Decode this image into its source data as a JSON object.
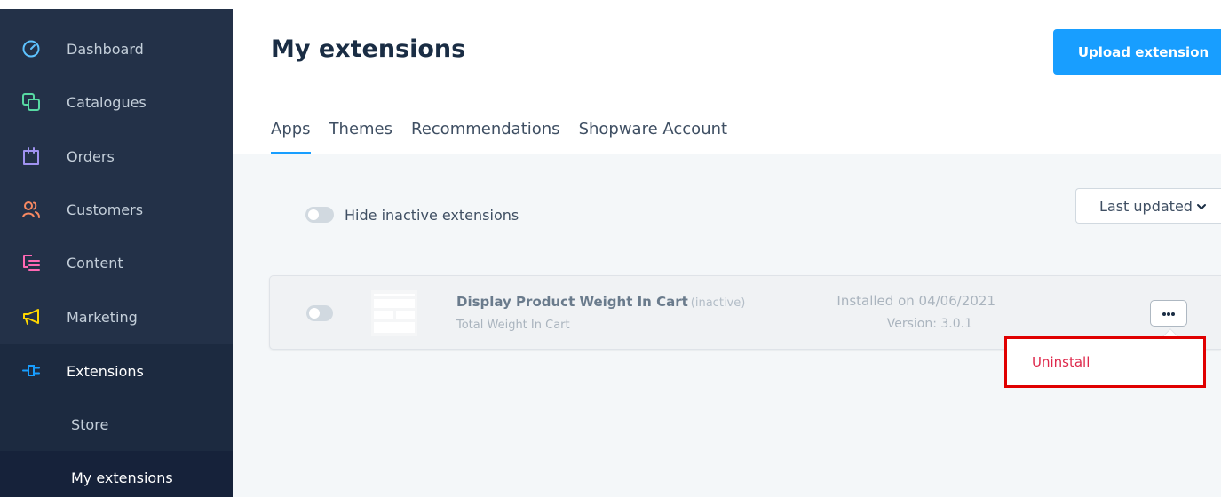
{
  "sidebar": {
    "items": [
      {
        "label": "Dashboard",
        "icon": "dashboard-gauge-icon",
        "color": "#5ec3ff"
      },
      {
        "label": "Catalogues",
        "icon": "catalogue-stack-icon",
        "color": "#57d9a3"
      },
      {
        "label": "Orders",
        "icon": "shopping-bag-icon",
        "color": "#a092f0"
      },
      {
        "label": "Customers",
        "icon": "users-icon",
        "color": "#f88962"
      },
      {
        "label": "Content",
        "icon": "content-layout-icon",
        "color": "#ff68b4"
      },
      {
        "label": "Marketing",
        "icon": "megaphone-icon",
        "color": "#ffd700"
      },
      {
        "label": "Extensions",
        "icon": "plug-icon",
        "color": "#189eff"
      }
    ],
    "sub_items": [
      {
        "label": "Store"
      },
      {
        "label": "My extensions"
      }
    ]
  },
  "header": {
    "title": "My extensions",
    "upload_button": "Upload extension"
  },
  "tabs": [
    {
      "label": "Apps",
      "active": true
    },
    {
      "label": "Themes"
    },
    {
      "label": "Recommendations"
    },
    {
      "label": "Shopware Account"
    }
  ],
  "filter": {
    "hide_inactive_label": "Hide inactive extensions",
    "hide_inactive_enabled": false
  },
  "sort": {
    "selected": "Last updated"
  },
  "extension": {
    "name": "Display Product Weight In Cart",
    "state": "(inactive)",
    "description": "Total Weight In Cart",
    "installed": "Installed on 04/06/2021",
    "version": "Version: 3.0.1",
    "active": false
  },
  "context_menu": {
    "items": [
      {
        "label": "Uninstall"
      }
    ]
  },
  "colors": {
    "accent": "#189eff",
    "sidebar_bg": "#233148",
    "danger": "#de294c",
    "highlight_border": "#e00000"
  }
}
